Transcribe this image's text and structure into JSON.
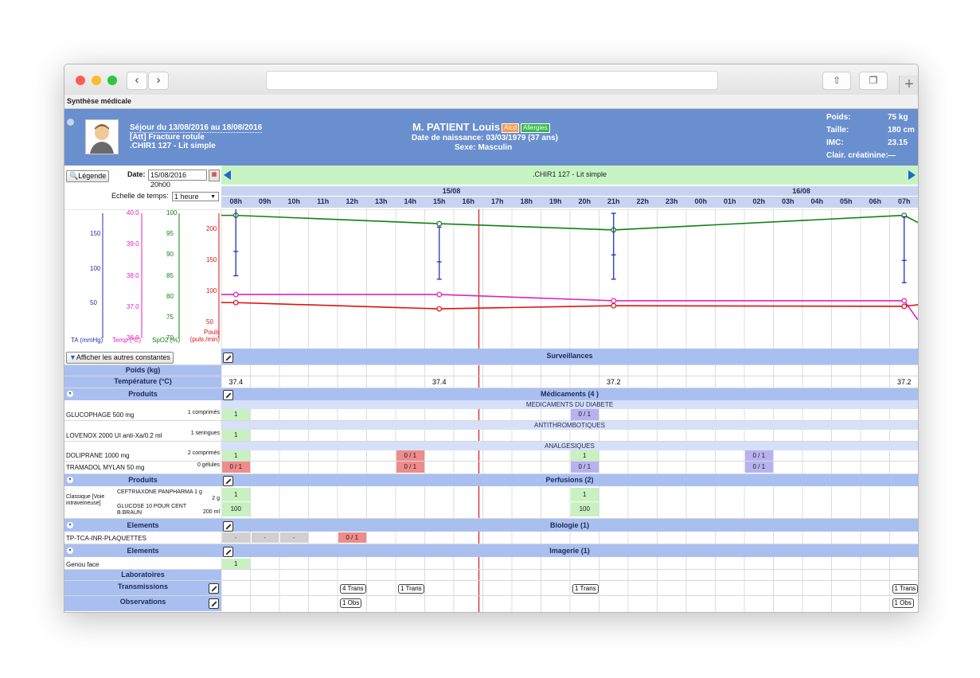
{
  "window": {
    "page_title": "Synthèse médicale"
  },
  "patient": {
    "stay": "Séjour du 13/08/2016 au 18/08/2016",
    "reason": "[Att] Fracture rotule",
    "location": ".CHIR1 127 - Lit simple",
    "name": "M. PATIENT Louis",
    "badge_atcd": "Atcd",
    "badge_allergies": "Allergies",
    "birth": "Date de naissance: 03/03/1979 (37 ans)",
    "sex": "Sexe: Masculin",
    "stats": [
      {
        "label": "Poids:",
        "value": "75 kg"
      },
      {
        "label": "Taille:",
        "value": "180 cm"
      },
      {
        "label": "IMC:",
        "value": "23.15"
      },
      {
        "label": "Clair. créatinine:",
        "value": "—"
      }
    ],
    "accent": "#6a8fcf"
  },
  "controls": {
    "legend": "Légende",
    "date_label": "Date:",
    "date_value": "15/08/2016 20h00",
    "bed_bar": ".CHIR1 127 - Lit simple",
    "timescale_label": "Echelle de temps:",
    "timescale_value": "1 heure",
    "show_constants": "Afficher les autres constantes"
  },
  "timeline": {
    "days": [
      "15/08",
      "16/08"
    ],
    "hours": [
      "08h",
      "09h",
      "10h",
      "11h",
      "12h",
      "13h",
      "14h",
      "15h",
      "16h",
      "17h",
      "18h",
      "19h",
      "20h",
      "21h",
      "22h",
      "23h",
      "00h",
      "01h",
      "02h",
      "03h",
      "04h",
      "05h",
      "06h",
      "07h"
    ]
  },
  "axes": {
    "ta": {
      "label": "TA (mmHg)",
      "ticks": [
        "150",
        "100",
        "50"
      ],
      "color": "#2030c0"
    },
    "temp": {
      "label": "Temp (°C)",
      "ticks": [
        "40.0",
        "39.0",
        "38.0",
        "37.0",
        "36.0"
      ],
      "color": "#e020c0"
    },
    "spo2": {
      "label": "SpO2 (%)",
      "ticks": [
        "100",
        "95",
        "90",
        "85",
        "80",
        "75",
        "70"
      ],
      "color": "#108010"
    },
    "pouls": {
      "label": "Pouls (puls./min)",
      "ticks": [
        "200",
        "150",
        "100",
        "50"
      ],
      "color": "#e01010"
    }
  },
  "chart_data": {
    "type": "line",
    "x": [
      "08h",
      "15h",
      "21h",
      "07h"
    ],
    "series": [
      {
        "name": "SpO2 (%)",
        "values": [
          99.5,
          97.5,
          96,
          99.5
        ],
        "color": "#108010"
      },
      {
        "name": "Temp (°C)",
        "values": [
          37.4,
          37.4,
          37.2,
          37.2
        ],
        "color": "#e020c0"
      },
      {
        "name": "Pouls (puls./min)",
        "values": [
          82,
          72,
          77,
          76
        ],
        "color": "#e01010"
      }
    ],
    "ta_ranges": [
      {
        "x": "08h",
        "low": 90,
        "high": 190,
        "mean": 125
      },
      {
        "x": "15h",
        "low": 85,
        "high": 160,
        "mean": 110
      },
      {
        "x": "21h",
        "low": 85,
        "high": 180,
        "mean": 120
      },
      {
        "x": "07h",
        "low": 80,
        "high": 175,
        "mean": 112
      }
    ],
    "marker_hour": "17h"
  },
  "sections": {
    "surveillances": "Surveillances",
    "poids": "Poids (kg)",
    "temperature": "Température (°C)",
    "temp_values": [
      {
        "hour": "08h",
        "v": "37.4"
      },
      {
        "hour": "15h",
        "v": "37.4"
      },
      {
        "hour": "21h",
        "v": "37.2"
      },
      {
        "hour": "07h",
        "v": "37.2"
      }
    ],
    "produits": "Produits",
    "medicaments": "Médicaments (4 )",
    "cat_diabete": "MEDICAMENTS DU DIABETE",
    "cat_antithrombo": "ANTITHROMBOTIQUES",
    "cat_analgesiques": "ANALGESIQUES",
    "meds": [
      {
        "name": "GLUCOPHAGE 500 mg",
        "qty": "1 comprimés"
      },
      {
        "name": "LOVENOX 2000 UI anti-Xa/0.2 ml",
        "qty": "1 seringues"
      },
      {
        "name": "DOLIPRANE 1000 mg",
        "qty": "2 comprimés"
      },
      {
        "name": "TRAMADOL MYLAN 50 mg",
        "qty": "0 gélules"
      }
    ],
    "perfusions": "Perfusions (2)",
    "perf_mode": "Classique [Voie intraveineuse]",
    "perfs": [
      {
        "name": "CEFTRIAXONE PANPHARMA 1 g",
        "qty": "2 g"
      },
      {
        "name": "GLUCOSE 10 POUR CENT B.BRAUN",
        "qty": "200 ml"
      }
    ],
    "elements": "Elements",
    "biologie": "Biologie (1)",
    "bio_item": "TP-TCA-INR-PLAQUETTES",
    "imagerie": "Imagerie (1)",
    "img_item": "Genou face",
    "laboratoires": "Laboratoires",
    "transmissions": "Transmissions",
    "observations": "Observations"
  },
  "cells": {
    "glucophage": [
      {
        "h": 0,
        "t": "1",
        "c": "g"
      },
      {
        "h": 12,
        "t": "0 / 1",
        "c": "p"
      }
    ],
    "lovenox": [
      {
        "h": 0,
        "t": "1",
        "c": "g"
      }
    ],
    "doliprane": [
      {
        "h": 0,
        "t": "1",
        "c": "g"
      },
      {
        "h": 6,
        "t": "0 / 1",
        "c": "r"
      },
      {
        "h": 12,
        "t": "1",
        "c": "g"
      },
      {
        "h": 18,
        "t": "0 / 1",
        "c": "p"
      }
    ],
    "tramadol": [
      {
        "h": 0,
        "t": "0 / 1",
        "c": "r"
      },
      {
        "h": 6,
        "t": "0 / 1",
        "c": "r"
      },
      {
        "h": 12,
        "t": "0 / 1",
        "c": "p"
      },
      {
        "h": 18,
        "t": "0 / 1",
        "c": "p"
      }
    ],
    "ceftriaxone": [
      {
        "h": 0,
        "t": "1",
        "c": "g"
      },
      {
        "h": 12,
        "t": "1",
        "c": "g"
      }
    ],
    "glucose": [
      {
        "h": 0,
        "t": "100",
        "c": "g"
      },
      {
        "h": 12,
        "t": "100",
        "c": "g"
      }
    ],
    "bio": [
      {
        "h": 0,
        "t": "-",
        "c": "gr"
      },
      {
        "h": 1,
        "t": "-",
        "c": "gr"
      },
      {
        "h": 2,
        "t": "-",
        "c": "gr"
      },
      {
        "h": 4,
        "t": "0 / 1",
        "c": "r"
      }
    ],
    "img": [
      {
        "h": 0,
        "t": "1",
        "c": "g"
      }
    ],
    "trans": [
      {
        "h": 4,
        "t": "4 Trans"
      },
      {
        "h": 6,
        "t": "1 Trans"
      },
      {
        "h": 12,
        "t": "1 Trans"
      },
      {
        "h": 23,
        "t": "1 Trans"
      }
    ],
    "obs": [
      {
        "h": 4,
        "t": "1 Obs"
      },
      {
        "h": 23,
        "t": "1 Obs"
      }
    ]
  }
}
